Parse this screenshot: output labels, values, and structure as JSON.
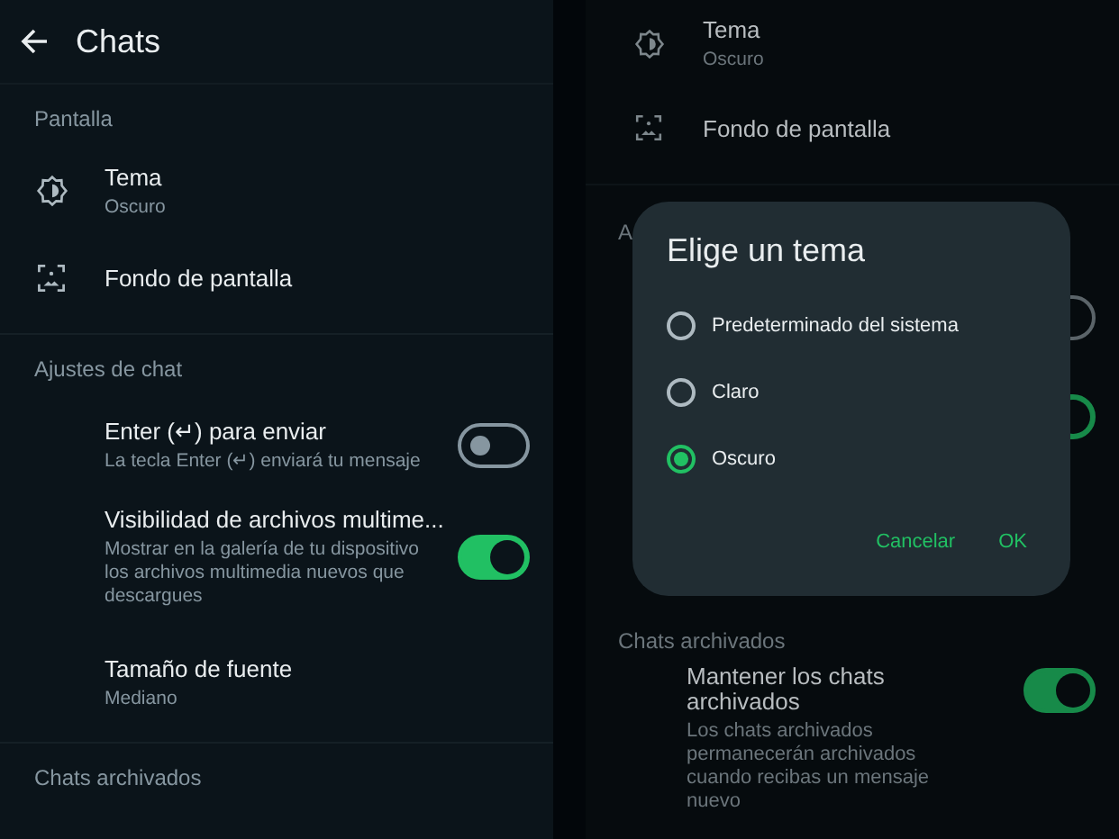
{
  "left": {
    "title": "Chats",
    "sections": [
      {
        "heading": "Pantalla",
        "items": [
          {
            "kind": "theme",
            "title": "Tema",
            "subtitle": "Oscuro"
          },
          {
            "kind": "wallpaper",
            "title": "Fondo de pantalla"
          }
        ]
      },
      {
        "heading": "Ajustes de chat",
        "items": [
          {
            "kind": "toggle",
            "title": "Enter (↵) para enviar",
            "subtitle": "La tecla Enter (↵) enviará tu mensaje",
            "on": false
          },
          {
            "kind": "toggle",
            "title": "Visibilidad de archivos multime...",
            "subtitle": "Mostrar en la galería de tu dispositivo los archivos multimedia nuevos que descargues",
            "on": true
          },
          {
            "kind": "text",
            "title": "Tamaño de fuente",
            "subtitle": "Mediano"
          }
        ]
      },
      {
        "heading": "Chats archivados"
      }
    ]
  },
  "right": {
    "items": [
      {
        "kind": "theme",
        "title": "Tema",
        "subtitle": "Oscuro"
      },
      {
        "kind": "wallpaper",
        "title": "Fondo de pantalla"
      }
    ],
    "partial_heading": "A",
    "hidden_toggles": [
      {
        "on": false
      },
      {
        "on": true
      }
    ],
    "archived": {
      "heading": "Chats archivados",
      "title": "Mantener los chats archivados",
      "subtitle": "Los chats archivados permanecerán archivados cuando recibas un mensaje nuevo",
      "on": true
    },
    "dialog": {
      "title": "Elige un tema",
      "options": [
        {
          "label": "Predeterminado del sistema",
          "selected": false
        },
        {
          "label": "Claro",
          "selected": false
        },
        {
          "label": "Oscuro",
          "selected": true
        }
      ],
      "buttons": [
        "Cancelar",
        "OK"
      ]
    }
  }
}
